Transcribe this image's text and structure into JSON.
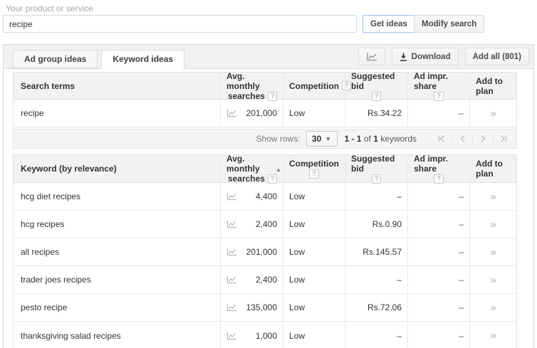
{
  "colors": {
    "accent_blue_border": "#9cc0f7",
    "panel_border": "#d9d9d9",
    "strip_bg": "#f1f1f1",
    "header_bg": "#f2f2f2",
    "row_border": "#e9e9e9",
    "muted_icon_gray": "#a9afb8",
    "muted_text": "#a5a5a5"
  },
  "search_bar": {
    "label": "Your product or service",
    "input_value": "recipe",
    "get_ideas": "Get ideas",
    "modify_search": "Modify search"
  },
  "tabs": {
    "ad_group": "Ad group ideas",
    "keyword": "Keyword ideas"
  },
  "toolbar": {
    "chart_icon": "line-chart-icon",
    "download": "Download",
    "add_all": "Add all (801)"
  },
  "columns": {
    "avg_monthly_line1": "Avg. monthly",
    "avg_monthly_line2": "searches",
    "competition": "Competition",
    "suggested_bid": "Suggested bid",
    "ad_impr_share": "Ad impr. share",
    "add_to_plan": "Add to plan",
    "help": "?"
  },
  "search_terms_table": {
    "first_col": "Search terms",
    "rows": [
      {
        "keyword": "recipe",
        "searches": "201,000",
        "competition": "Low",
        "bid": "Rs.34.22",
        "impr": "–"
      }
    ]
  },
  "pagination": {
    "show_rows": "Show rows:",
    "rows_value": "30",
    "range": "1 - 1",
    "of_label": "of",
    "total": "1",
    "unit": "keywords"
  },
  "keyword_table": {
    "first_col": "Keyword (by relevance)",
    "rows": [
      {
        "keyword": "hcg diet recipes",
        "searches": "4,400",
        "competition": "Low",
        "bid": "–",
        "impr": "–"
      },
      {
        "keyword": "hcg recipes",
        "searches": "2,400",
        "competition": "Low",
        "bid": "Rs.0.90",
        "impr": "–"
      },
      {
        "keyword": "all recipes",
        "searches": "201,000",
        "competition": "Low",
        "bid": "Rs.145.57",
        "impr": "–"
      },
      {
        "keyword": "trader joes recipes",
        "searches": "2,400",
        "competition": "Low",
        "bid": "–",
        "impr": "–"
      },
      {
        "keyword": "pesto recipe",
        "searches": "135,000",
        "competition": "Low",
        "bid": "Rs.72.06",
        "impr": "–"
      },
      {
        "keyword": "thanksgiving salad recipes",
        "searches": "1,000",
        "competition": "Low",
        "bid": "–",
        "impr": "–"
      }
    ]
  },
  "icons": {
    "add_to_plan_glyph": "»",
    "dropdown_arrow": "▼",
    "sort_asc_glyph": "▲"
  }
}
